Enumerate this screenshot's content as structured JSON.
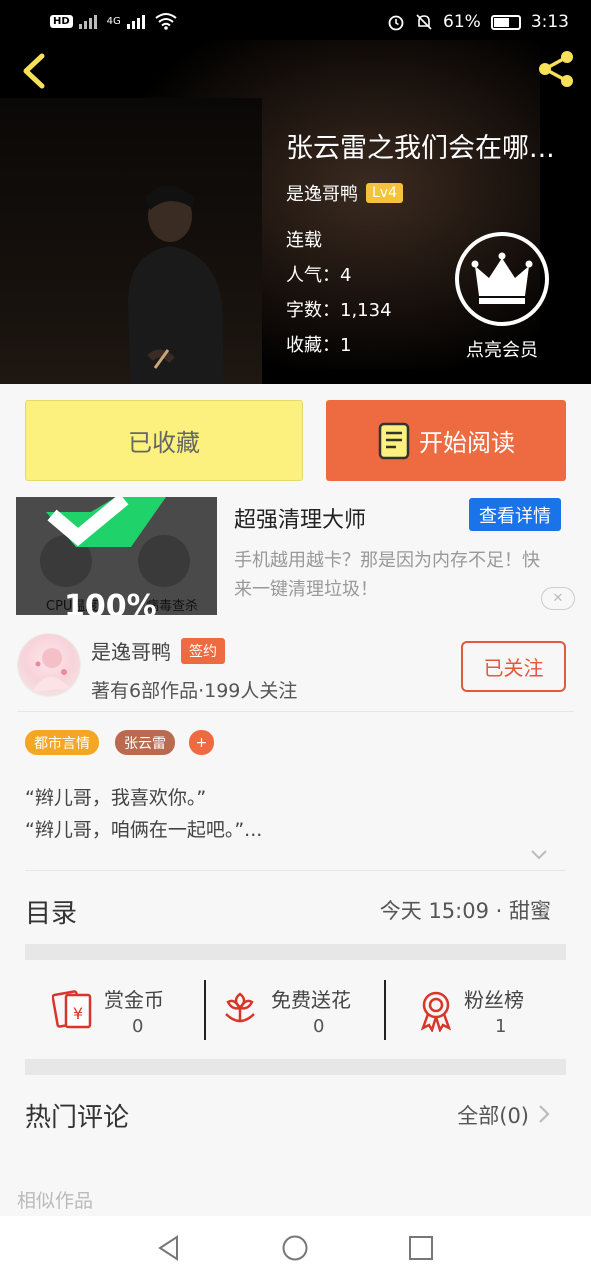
{
  "status_bar": {
    "left_badge": "HD",
    "network": "4G",
    "battery": "61%",
    "time": "3:13"
  },
  "book": {
    "title": "张云雷之我们会在哪...",
    "author": "是逸哥鸭",
    "level": "Lv4",
    "status": "连载",
    "popularity": "人气：4",
    "word_count": "字数：1,134",
    "favorites": "收藏：1"
  },
  "vip": {
    "label": "点亮会员"
  },
  "actions": {
    "collected_label": "已收藏",
    "read_label": "开始阅读"
  },
  "ad": {
    "image_text_1": "CPU温度",
    "image_text_2": "病毒查杀",
    "image_text_3": "100%",
    "title": "超强清理大师",
    "detail_label": "查看详情",
    "description": "手机越用越卡？那是因为内存不足！快来一键清理垃圾！",
    "close_label": "✕"
  },
  "author_card": {
    "name": "是逸哥鸭",
    "badge": "签约",
    "stats": "著有6部作品·199人关注",
    "follow_label": "已关注"
  },
  "tags": [
    "都市言情",
    "张云雷",
    "+"
  ],
  "description": {
    "line1": "“辫儿哥，我喜欢你。”",
    "line2": "“辫儿哥，咱俩在一起吧。”..."
  },
  "toc": {
    "title": "目录",
    "latest": "今天 15:09 · 甜蜜"
  },
  "gifts": [
    {
      "label": "赏金币",
      "count": "0",
      "icon": "red-envelope-icon"
    },
    {
      "label": "免费送花",
      "count": "0",
      "icon": "flower-icon"
    },
    {
      "label": "粉丝榜",
      "count": "1",
      "icon": "medal-icon"
    }
  ],
  "comments": {
    "title": "热门评论",
    "all_label": "全部(0)"
  },
  "similar": {
    "title": "相似作品"
  },
  "colors": {
    "accent_orange": "#ee6b41",
    "collected_yellow": "#fcf07f",
    "level_yellow": "#f5c33a",
    "ad_blue": "#1a73e8",
    "back_yellow": "#f7e15a"
  }
}
